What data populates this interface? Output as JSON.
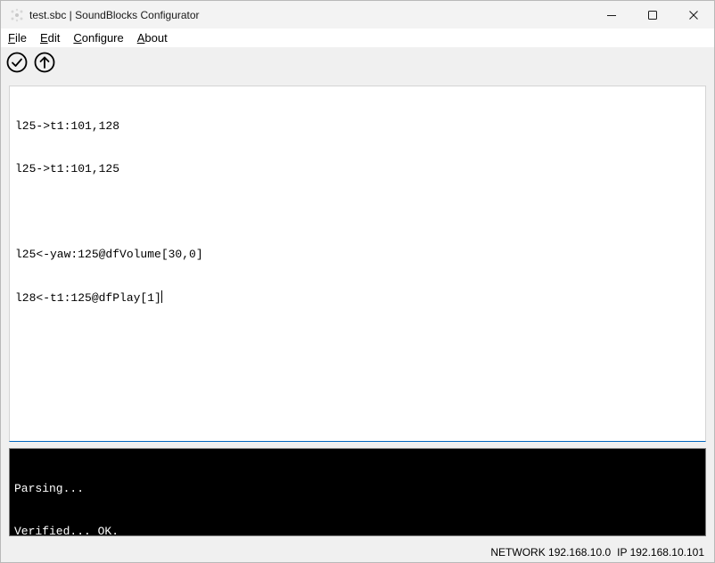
{
  "window": {
    "title": "test.sbc | SoundBlocks Configurator",
    "caption_buttons": [
      "minimize-icon",
      "maximize-icon",
      "close-icon"
    ]
  },
  "menu": {
    "items": [
      {
        "accel": "F",
        "rest": "ile"
      },
      {
        "accel": "E",
        "rest": "dit"
      },
      {
        "accel": "C",
        "rest": "onfigure"
      },
      {
        "accel": "A",
        "rest": "bout"
      }
    ]
  },
  "toolbar": {
    "buttons": [
      "verify-check-icon",
      "upload-arrow-icon"
    ]
  },
  "editor": {
    "lines": [
      "l25->t1:101,128",
      "l25->t1:101,125",
      "",
      "l25<-yaw:125@dfVolume[30,0]",
      "l28<-t1:125@dfPlay[1]"
    ]
  },
  "console": {
    "lines": [
      "Parsing...",
      "Verified... OK."
    ]
  },
  "status": {
    "network": "NETWORK 192.168.10.0",
    "ip": "IP 192.168.10.101"
  },
  "colors": {
    "focus_accent": "#0067c0",
    "console_bg": "#000000",
    "console_fg": "#ffffff"
  }
}
